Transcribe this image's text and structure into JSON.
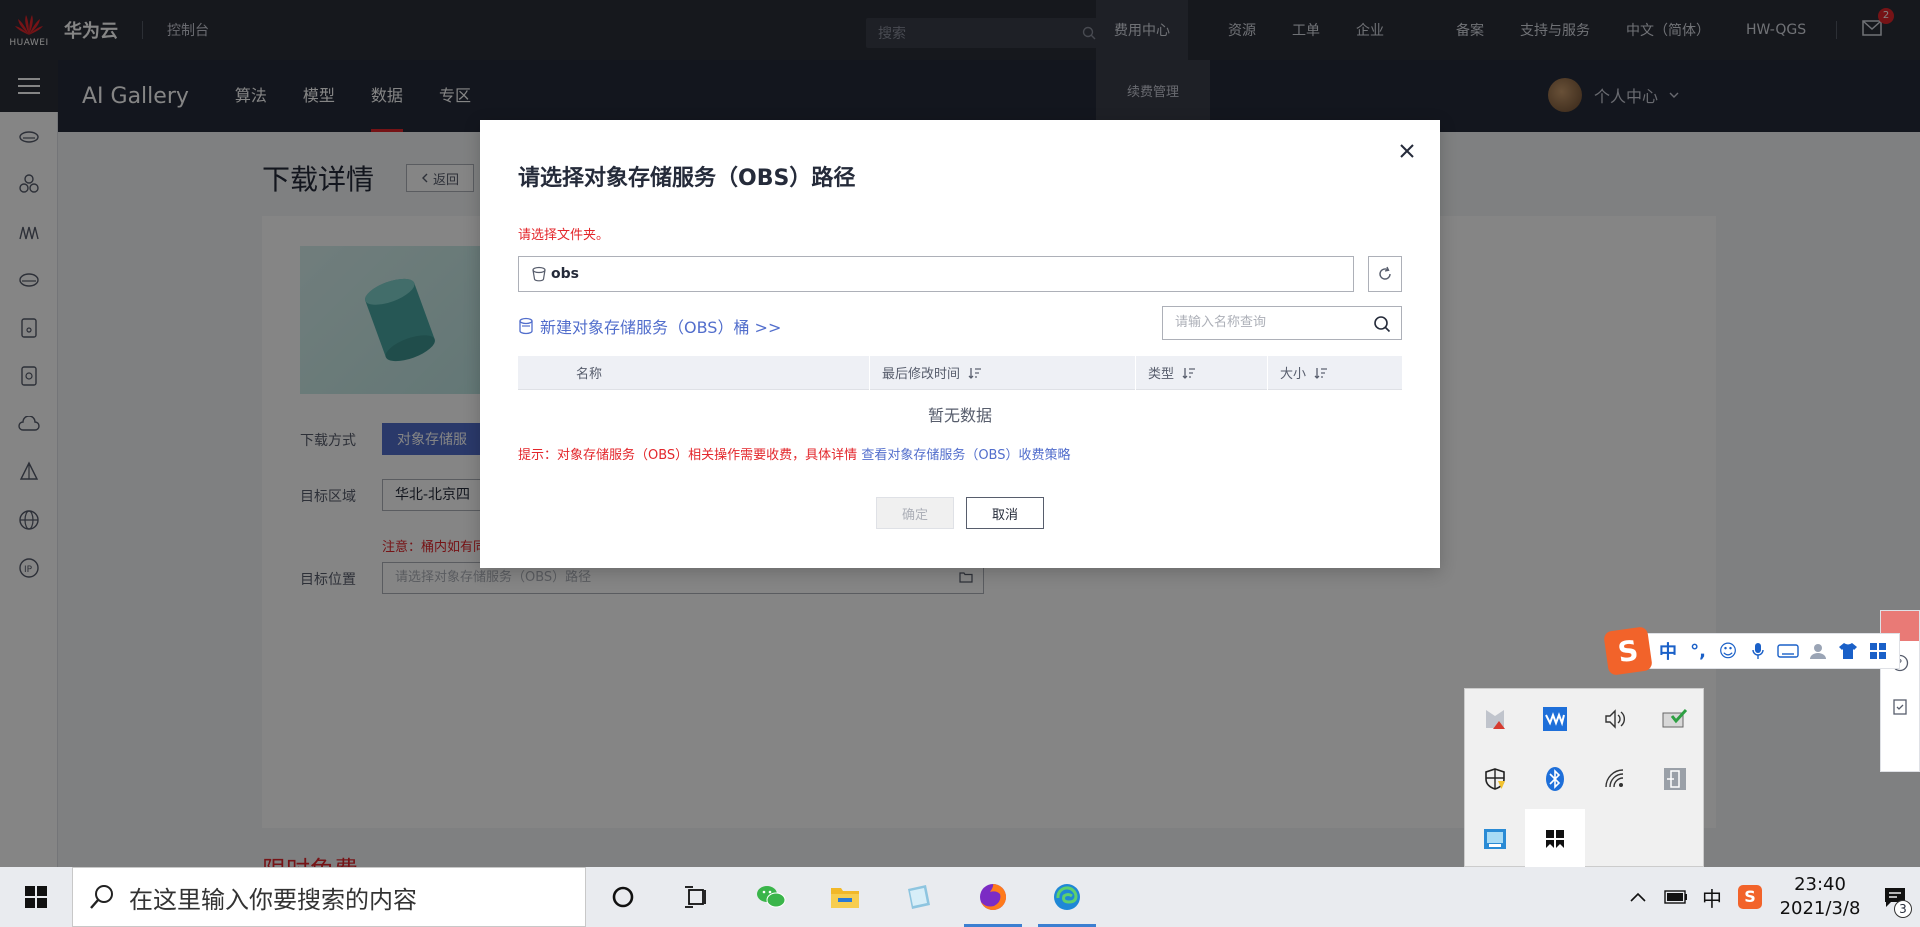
{
  "topbar": {
    "logo_text": "HUAWEI",
    "brand": "华为云",
    "console": "控制台",
    "search_placeholder": "搜索",
    "menu": [
      "费用中心",
      "资源",
      "工单",
      "企业",
      "备案",
      "支持与服务",
      "中文（简体）",
      "HW-QGS"
    ],
    "submenu_item": "续费管理",
    "mail_count": "2"
  },
  "subbar": {
    "title": "AI Gallery",
    "tabs": [
      "算法",
      "模型",
      "数据",
      "专区"
    ],
    "active_tab": "数据",
    "profile": "个人中心"
  },
  "page": {
    "title": "下载详情",
    "back": "返回",
    "labels": {
      "method": "下载方式",
      "region": "目标区域",
      "location": "目标位置"
    },
    "method_button": "对象存储服",
    "region_value": "华北-北京四",
    "warning": "注意：桶内如有同",
    "path_placeholder": "请选择对象存储服务（OBS）路径",
    "bottom_title": "限时免费"
  },
  "dialog": {
    "title": "请选择对象存储服务（OBS）路径",
    "hint": "请选择文件夹。",
    "path_value": "obs",
    "new_bucket": "新建对象存储服务（OBS）桶 >>",
    "search_placeholder": "请输入名称查询",
    "columns": [
      "名称",
      "最后修改时间",
      "类型",
      "大小"
    ],
    "empty": "暂无数据",
    "tip_prefix": "提示：对象存储服务（OBS）相关操作需要收费，具体详情",
    "tip_link": "查看对象存储服务（OBS）收费策略",
    "ok": "确定",
    "cancel": "取消"
  },
  "ime": {
    "mode": "中"
  },
  "taskbar": {
    "search_text": "在这里输入你要搜索的内容",
    "ime_indicator": "中",
    "time": "23:40",
    "date": "2021/3/8",
    "notif_count": "3"
  }
}
